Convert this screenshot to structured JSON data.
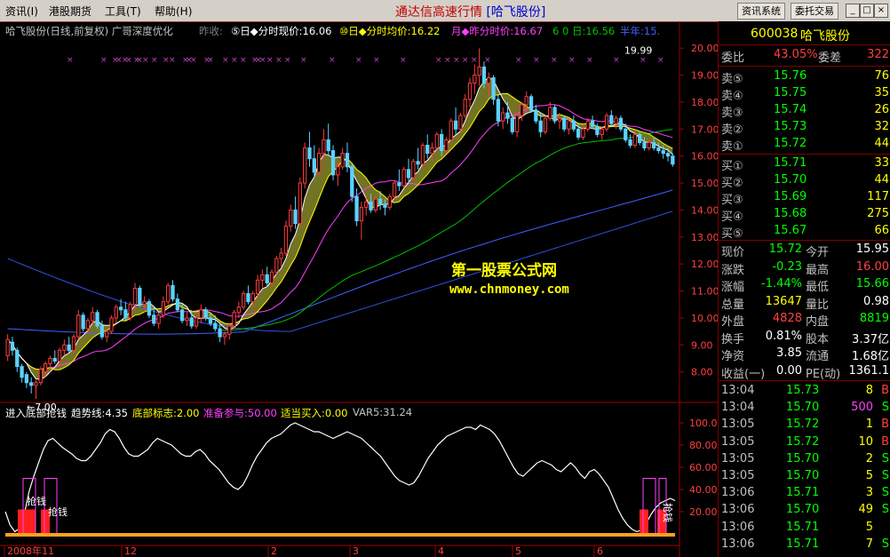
{
  "menu": {
    "items": [
      "资讯(I)",
      "港股期货",
      "工具(T)",
      "帮助(H)"
    ],
    "app_title": "通达信高速行情",
    "stock_tag": "[哈飞股份]",
    "sys_buttons": [
      "资讯系统",
      "委托交易"
    ],
    "win_buttons": [
      "_",
      "□",
      "×"
    ]
  },
  "chart_header": {
    "title": "哈飞股份(日线,前复权) 广哥深度优化",
    "prev_close": "昨收:",
    "items": [
      "⑤日◆分时现价:16.06",
      "⑩日◆分时均价:16.22",
      "月◆昨分时价:16.67",
      "6 0 日:16.56",
      "半年:15."
    ]
  },
  "colors": {
    "up": "#ff3c3c",
    "down": "#5ad2ff",
    "ma5": "#ffffff",
    "ma10": "#ffff00",
    "ma20": "#ff40ff",
    "ma60": "#00c000",
    "ma120": "#4060ff",
    "ma250": "#ffffff"
  },
  "chart_data": [
    {
      "type": "candlestick",
      "title": "哈飞股份(日线,前复权)",
      "y_ticks": [
        "20.00",
        "19.00",
        "18.00",
        "17.00",
        "16.00",
        "15.00",
        "14.00",
        "13.00",
        "12.00",
        "11.00",
        "10.00",
        "9.00",
        "8.00"
      ],
      "ylim": [
        7.0,
        20.4
      ],
      "annotations": [
        {
          "label": "19.99",
          "x": 130,
          "y": 19.99
        },
        {
          "label": "←7.00",
          "x": 8,
          "y": 7.0
        }
      ],
      "candles": [
        [
          8.6,
          9.4,
          8.4,
          9.2
        ],
        [
          9.1,
          9.3,
          8.6,
          8.8
        ],
        [
          8.8,
          8.9,
          8.0,
          8.2
        ],
        [
          8.2,
          8.3,
          7.6,
          7.8
        ],
        [
          7.9,
          8.0,
          7.4,
          7.6
        ],
        [
          7.6,
          7.8,
          7.2,
          7.5
        ],
        [
          7.5,
          7.7,
          7.0,
          7.6
        ],
        [
          7.6,
          8.2,
          7.5,
          8.1
        ],
        [
          8.0,
          8.4,
          7.8,
          8.3
        ],
        [
          8.3,
          8.6,
          8.0,
          8.5
        ],
        [
          8.5,
          8.8,
          8.3,
          8.4
        ],
        [
          8.4,
          8.9,
          8.2,
          8.8
        ],
        [
          8.8,
          9.2,
          8.6,
          9.0
        ],
        [
          9.0,
          9.3,
          8.7,
          8.8
        ],
        [
          8.8,
          9.4,
          8.7,
          9.3
        ],
        [
          9.3,
          10.3,
          9.2,
          10.1
        ],
        [
          10.1,
          10.2,
          9.5,
          9.6
        ],
        [
          9.6,
          10.0,
          9.4,
          9.9
        ],
        [
          9.9,
          10.4,
          9.7,
          10.2
        ],
        [
          10.2,
          10.3,
          9.6,
          9.7
        ],
        [
          9.7,
          9.9,
          9.2,
          9.3
        ],
        [
          9.3,
          9.6,
          9.1,
          9.5
        ],
        [
          9.5,
          10.1,
          9.4,
          10.0
        ],
        [
          10.0,
          10.5,
          9.8,
          10.4
        ],
        [
          10.4,
          10.7,
          10.1,
          10.3
        ],
        [
          10.3,
          10.6,
          9.9,
          10.0
        ],
        [
          10.0,
          10.6,
          9.9,
          10.5
        ],
        [
          10.5,
          11.3,
          10.3,
          11.1
        ],
        [
          11.1,
          11.2,
          10.4,
          10.5
        ],
        [
          10.5,
          10.8,
          10.2,
          10.6
        ],
        [
          10.6,
          10.7,
          10.0,
          10.1
        ],
        [
          10.1,
          10.4,
          9.7,
          9.8
        ],
        [
          9.8,
          10.2,
          9.6,
          10.1
        ],
        [
          10.1,
          10.8,
          10.0,
          10.6
        ],
        [
          10.6,
          11.3,
          10.5,
          11.2
        ],
        [
          11.2,
          11.4,
          10.6,
          10.7
        ],
        [
          10.7,
          10.9,
          10.2,
          10.3
        ],
        [
          10.3,
          10.5,
          9.8,
          9.9
        ],
        [
          9.9,
          10.2,
          9.7,
          10.0
        ],
        [
          10.0,
          10.3,
          9.6,
          9.7
        ],
        [
          9.7,
          10.1,
          9.6,
          10.0
        ],
        [
          10.0,
          10.5,
          9.8,
          10.3
        ],
        [
          10.3,
          10.4,
          9.9,
          10.0
        ],
        [
          10.0,
          10.2,
          9.7,
          9.8
        ],
        [
          9.8,
          10.1,
          9.5,
          9.6
        ],
        [
          9.6,
          9.8,
          9.1,
          9.3
        ],
        [
          9.3,
          9.5,
          9.0,
          9.4
        ],
        [
          9.4,
          9.8,
          9.2,
          9.7
        ],
        [
          9.7,
          10.3,
          9.6,
          10.2
        ],
        [
          10.2,
          10.6,
          10.0,
          10.4
        ],
        [
          10.4,
          11.0,
          10.3,
          10.9
        ],
        [
          10.9,
          11.2,
          10.5,
          10.6
        ],
        [
          10.6,
          11.0,
          10.4,
          10.9
        ],
        [
          10.9,
          11.6,
          10.8,
          11.4
        ],
        [
          11.4,
          11.8,
          11.1,
          11.6
        ],
        [
          11.6,
          11.9,
          11.2,
          11.3
        ],
        [
          11.3,
          11.8,
          11.2,
          11.7
        ],
        [
          11.7,
          12.3,
          11.6,
          12.2
        ],
        [
          12.2,
          12.6,
          11.9,
          12.4
        ],
        [
          12.4,
          13.6,
          12.3,
          13.4
        ],
        [
          13.4,
          14.2,
          13.2,
          14.0
        ],
        [
          14.0,
          14.5,
          13.3,
          13.5
        ],
        [
          13.5,
          15.2,
          13.4,
          15.0
        ],
        [
          15.0,
          16.5,
          14.8,
          16.3
        ],
        [
          16.3,
          16.9,
          15.6,
          15.9
        ],
        [
          15.9,
          16.4,
          15.2,
          15.4
        ],
        [
          15.4,
          16.3,
          15.3,
          16.1
        ],
        [
          16.1,
          17.0,
          15.9,
          16.6
        ],
        [
          16.6,
          17.2,
          16.0,
          16.2
        ],
        [
          16.2,
          16.4,
          15.1,
          15.3
        ],
        [
          15.3,
          15.8,
          14.9,
          15.6
        ],
        [
          15.6,
          16.3,
          15.5,
          16.1
        ],
        [
          16.1,
          16.5,
          15.4,
          15.6
        ],
        [
          15.6,
          15.7,
          14.3,
          14.5
        ],
        [
          14.5,
          14.8,
          13.4,
          13.6
        ],
        [
          13.6,
          14.3,
          12.9,
          14.1
        ],
        [
          14.1,
          14.5,
          13.8,
          14.3
        ],
        [
          14.3,
          14.6,
          13.9,
          14.0
        ],
        [
          14.0,
          14.5,
          13.9,
          14.4
        ],
        [
          14.4,
          14.7,
          14.0,
          14.2
        ],
        [
          14.2,
          14.4,
          13.8,
          14.1
        ],
        [
          14.1,
          14.6,
          14.0,
          14.5
        ],
        [
          14.5,
          15.1,
          14.4,
          15.0
        ],
        [
          15.0,
          15.5,
          14.7,
          14.9
        ],
        [
          14.9,
          15.6,
          14.8,
          15.5
        ],
        [
          15.5,
          15.9,
          15.0,
          15.2
        ],
        [
          15.2,
          15.9,
          15.1,
          15.8
        ],
        [
          15.8,
          16.3,
          15.5,
          15.7
        ],
        [
          15.7,
          16.5,
          15.6,
          16.4
        ],
        [
          16.4,
          16.8,
          15.9,
          16.1
        ],
        [
          16.1,
          16.5,
          15.8,
          16.3
        ],
        [
          16.3,
          16.9,
          16.2,
          16.8
        ],
        [
          16.8,
          17.0,
          16.0,
          16.2
        ],
        [
          16.2,
          16.7,
          16.1,
          16.6
        ],
        [
          16.6,
          17.4,
          16.5,
          17.3
        ],
        [
          17.3,
          17.8,
          16.8,
          17.0
        ],
        [
          17.0,
          17.6,
          16.9,
          17.5
        ],
        [
          17.5,
          18.3,
          17.4,
          18.1
        ],
        [
          18.1,
          18.9,
          17.8,
          18.7
        ],
        [
          18.7,
          19.4,
          18.3,
          19.0
        ],
        [
          19.0,
          19.99,
          18.6,
          19.3
        ],
        [
          19.3,
          19.5,
          18.5,
          18.7
        ],
        [
          18.7,
          19.1,
          18.2,
          18.9
        ],
        [
          18.9,
          19.0,
          17.9,
          18.1
        ],
        [
          18.1,
          18.3,
          17.1,
          17.3
        ],
        [
          17.3,
          17.8,
          17.0,
          17.6
        ],
        [
          17.6,
          18.0,
          17.2,
          17.4
        ],
        [
          17.4,
          17.5,
          16.8,
          16.9
        ],
        [
          16.9,
          17.6,
          16.7,
          17.5
        ],
        [
          17.5,
          18.0,
          17.3,
          17.9
        ],
        [
          17.9,
          18.4,
          17.6,
          18.2
        ],
        [
          18.2,
          18.3,
          17.6,
          17.7
        ],
        [
          17.7,
          17.9,
          17.2,
          17.3
        ],
        [
          17.3,
          17.6,
          16.7,
          16.9
        ],
        [
          16.9,
          17.5,
          16.8,
          17.4
        ],
        [
          17.4,
          18.0,
          17.3,
          17.8
        ],
        [
          17.8,
          17.9,
          17.2,
          17.3
        ],
        [
          17.3,
          17.6,
          17.0,
          17.4
        ],
        [
          17.4,
          17.5,
          16.9,
          17.0
        ],
        [
          17.0,
          17.4,
          16.8,
          17.3
        ],
        [
          17.3,
          17.5,
          16.9,
          17.0
        ],
        [
          17.0,
          17.2,
          16.6,
          16.7
        ],
        [
          16.7,
          17.1,
          16.6,
          17.0
        ],
        [
          17.0,
          17.4,
          16.9,
          17.3
        ],
        [
          17.3,
          17.5,
          17.0,
          17.1
        ],
        [
          17.1,
          17.2,
          16.7,
          16.8
        ],
        [
          16.8,
          17.1,
          16.6,
          17.0
        ],
        [
          17.0,
          17.6,
          16.9,
          17.5
        ],
        [
          17.5,
          17.7,
          17.1,
          17.2
        ],
        [
          17.2,
          17.5,
          17.0,
          17.4
        ],
        [
          17.4,
          17.5,
          16.9,
          17.0
        ],
        [
          17.0,
          17.2,
          16.5,
          16.6
        ],
        [
          16.6,
          16.8,
          16.3,
          16.4
        ],
        [
          16.4,
          16.9,
          16.3,
          16.8
        ],
        [
          16.8,
          16.9,
          16.4,
          16.5
        ],
        [
          16.5,
          16.7,
          16.2,
          16.3
        ],
        [
          16.3,
          16.6,
          16.2,
          16.5
        ],
        [
          16.5,
          16.7,
          16.2,
          16.3
        ],
        [
          16.3,
          16.5,
          16.1,
          16.2
        ],
        [
          16.2,
          16.4,
          15.9,
          16.1
        ],
        [
          16.1,
          16.3,
          15.8,
          16.0
        ],
        [
          16.0,
          16.1,
          15.6,
          15.7
        ]
      ]
    },
    {
      "type": "line",
      "title": "进入底部抢钱",
      "legend": [
        "进入底部抢钱",
        "趋势线:4.35",
        "底部标志:2.00",
        "准备参与:50.00",
        "适当买入:0.00",
        "VAR5:31.24"
      ],
      "y_ticks": [
        "100.0",
        "80.00",
        "60.00",
        "40.00",
        "20.00"
      ],
      "ylim": [
        -4,
        108
      ],
      "x_ticks": [
        "2008年11",
        "12",
        "2",
        "3",
        "4",
        "5",
        "6"
      ],
      "labels": [
        "抢钱",
        "抢钱",
        "抢钱"
      ],
      "trend": [
        20,
        8,
        2,
        5,
        18,
        38,
        52,
        64,
        76,
        84,
        86,
        82,
        78,
        75,
        72,
        68,
        66,
        66,
        70,
        76,
        82,
        90,
        94,
        92,
        86,
        78,
        72,
        70,
        70,
        73,
        76,
        82,
        86,
        84,
        82,
        80,
        76,
        72,
        70,
        70,
        74,
        76,
        72,
        66,
        62,
        58,
        52,
        46,
        42,
        40,
        44,
        52,
        62,
        70,
        76,
        82,
        86,
        88,
        90,
        94,
        98,
        100,
        98,
        96,
        94,
        92,
        92,
        90,
        88,
        86,
        88,
        90,
        92,
        90,
        88,
        86,
        82,
        78,
        74,
        70,
        64,
        58,
        52,
        48,
        46,
        44,
        46,
        52,
        60,
        68,
        74,
        80,
        84,
        88,
        90,
        92,
        94,
        96,
        96,
        94,
        98,
        96,
        94,
        90,
        84,
        76,
        68,
        60,
        54,
        52,
        56,
        60,
        64,
        66,
        64,
        62,
        58,
        56,
        60,
        64,
        60,
        54,
        50,
        56,
        58,
        54,
        48,
        42,
        32,
        22,
        14,
        8,
        4,
        2,
        4,
        10,
        18,
        24,
        28,
        30,
        32,
        30
      ]
    }
  ],
  "quote": {
    "code": "600038",
    "name": "哈飞股份",
    "weibi_label": "委比",
    "weibi": "43.05%",
    "weicha_label": "委差",
    "weicha": "322",
    "sell": [
      {
        "label": "卖⑤",
        "price": "15.76",
        "vol": "76"
      },
      {
        "label": "卖④",
        "price": "15.75",
        "vol": "35"
      },
      {
        "label": "卖③",
        "price": "15.74",
        "vol": "26"
      },
      {
        "label": "卖②",
        "price": "15.73",
        "vol": "32"
      },
      {
        "label": "卖①",
        "price": "15.72",
        "vol": "44"
      }
    ],
    "buy": [
      {
        "label": "买①",
        "price": "15.71",
        "vol": "33"
      },
      {
        "label": "买②",
        "price": "15.70",
        "vol": "44"
      },
      {
        "label": "买③",
        "price": "15.69",
        "vol": "117"
      },
      {
        "label": "买④",
        "price": "15.68",
        "vol": "275"
      },
      {
        "label": "买⑤",
        "price": "15.67",
        "vol": "66"
      }
    ],
    "stats": [
      {
        "l1": "现价",
        "v1": "15.72",
        "c1": "#00ff00",
        "l2": "今开",
        "v2": "15.95",
        "c2": "#ffffff"
      },
      {
        "l1": "涨跌",
        "v1": "-0.23",
        "c1": "#00ff00",
        "l2": "最高",
        "v2": "16.00",
        "c2": "#ff4040"
      },
      {
        "l1": "涨幅",
        "v1": "-1.44%",
        "c1": "#00ff00",
        "l2": "最低",
        "v2": "15.66",
        "c2": "#00ff00"
      },
      {
        "l1": "总量",
        "v1": "13647",
        "c1": "#ffff00",
        "l2": "量比",
        "v2": "0.98",
        "c2": "#ffffff"
      },
      {
        "l1": "外盘",
        "v1": "4828",
        "c1": "#ff4040",
        "l2": "内盘",
        "v2": "8819",
        "c2": "#00ff00"
      },
      {
        "l1": "换手",
        "v1": "0.81%",
        "c1": "#ffffff",
        "l2": "股本",
        "v2": "3.37亿",
        "c2": "#ffffff"
      },
      {
        "l1": "净资",
        "v1": "3.85",
        "c1": "#ffffff",
        "l2": "流通",
        "v2": "1.68亿",
        "c2": "#ffffff"
      },
      {
        "l1": "收益(一)",
        "v1": "0.00",
        "c1": "#ffffff",
        "l2": "PE(动)",
        "v2": "1361.1",
        "c2": "#ffffff"
      }
    ],
    "ticks": [
      {
        "time": "13:04",
        "price": "15.73",
        "vol": "8",
        "side": "B"
      },
      {
        "time": "13:04",
        "price": "15.70",
        "vol": "500",
        "side": "S"
      },
      {
        "time": "13:05",
        "price": "15.72",
        "vol": "1",
        "side": "B"
      },
      {
        "time": "13:05",
        "price": "15.72",
        "vol": "10",
        "side": "B"
      },
      {
        "time": "13:05",
        "price": "15.70",
        "vol": "2",
        "side": "S"
      },
      {
        "time": "13:05",
        "price": "15.70",
        "vol": "5",
        "side": "S"
      },
      {
        "time": "13:06",
        "price": "15.71",
        "vol": "3",
        "side": "S"
      },
      {
        "time": "13:06",
        "price": "15.70",
        "vol": "49",
        "side": "S"
      },
      {
        "time": "13:06",
        "price": "15.71",
        "vol": "5",
        "side": ""
      },
      {
        "time": "13:06",
        "price": "15.71",
        "vol": "7",
        "side": "S"
      }
    ]
  },
  "watermark": {
    "line1": "第一股票公式网",
    "line2": "www.chnmoney.com"
  }
}
